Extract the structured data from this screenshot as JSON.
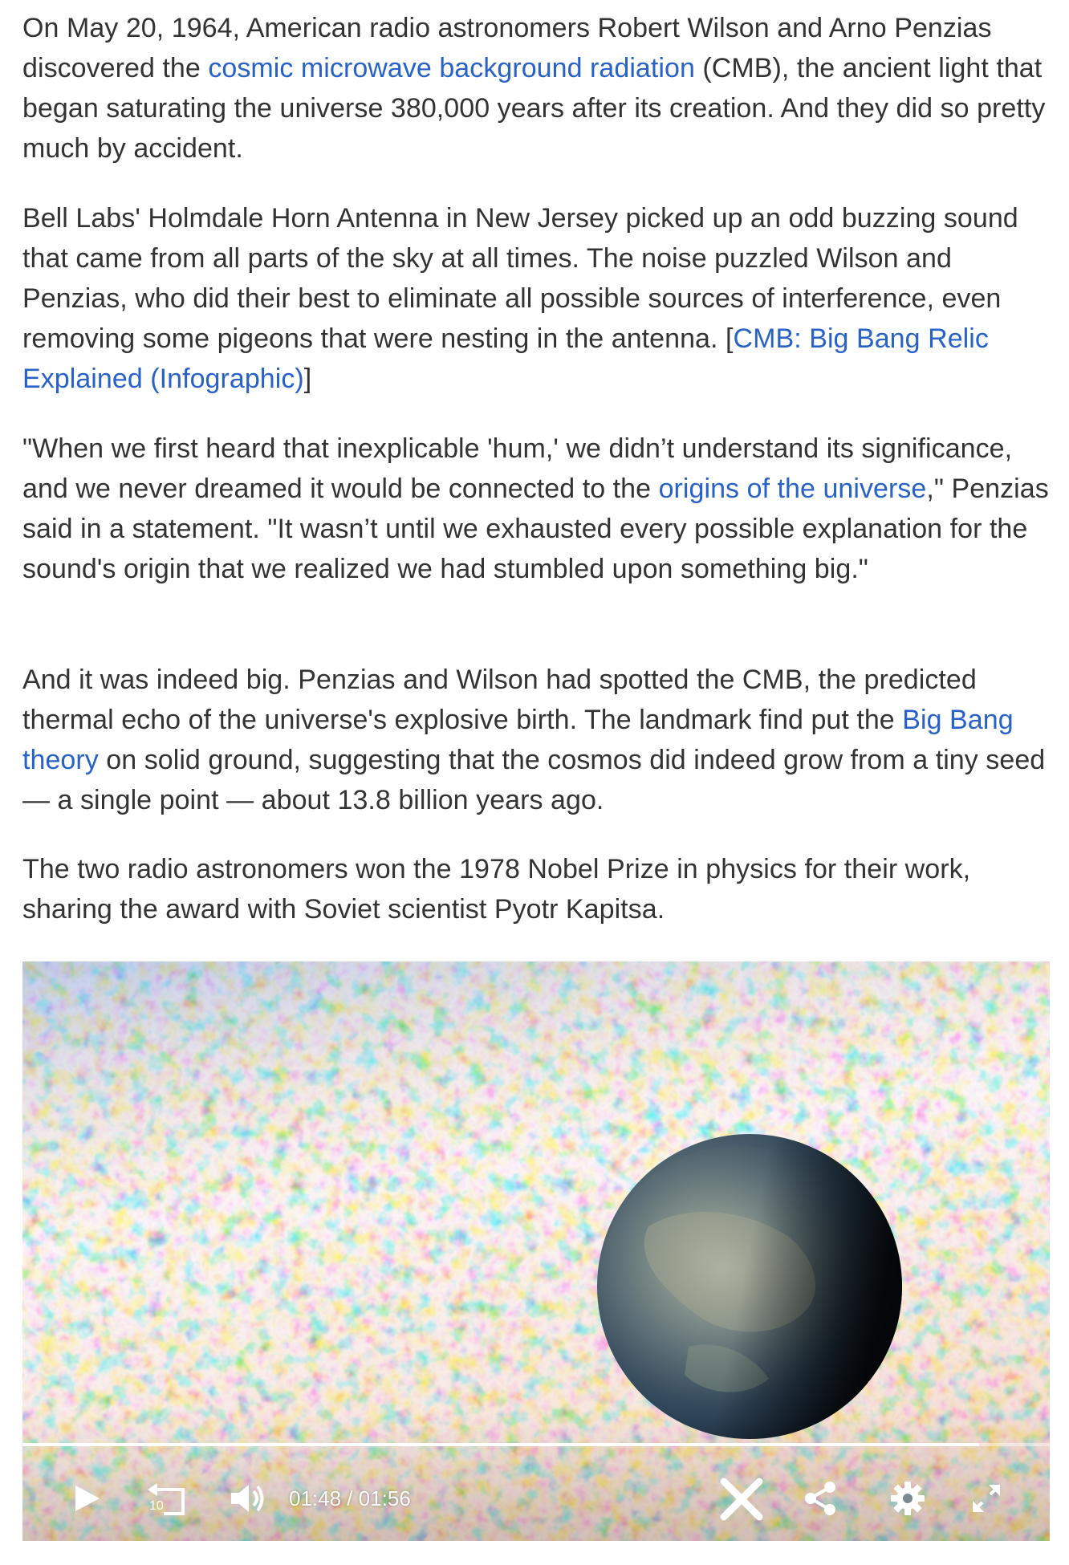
{
  "article": {
    "p1": {
      "before": "On May 20, 1964, American radio astronomers Robert Wilson and Arno Penzias discovered the ",
      "link": "cosmic microwave background radiation",
      "after": " (CMB), the ancient light that began saturating the universe 380,000 years after its creation. And they did so pretty much by accident."
    },
    "p2": {
      "before": "Bell Labs' Holmdale Horn Antenna in New Jersey picked up an odd buzzing sound that came from all parts of the sky at all times. The noise puzzled Wilson and Penzias, who did their best to eliminate all possible sources of interference, even removing some pigeons that were nesting in the antenna. [",
      "link": "CMB: Big Bang Relic Explained (Infographic)",
      "after": "]"
    },
    "p3": {
      "before": "\"When we first heard that inexplicable 'hum,' we didn’t understand its significance, and we never dreamed it would be connected to the ",
      "link": "origins of the universe",
      "after": ",\" Penzias said in a statement. \"It wasn’t until we exhausted every possible explanation for the sound's origin that we realized we had stumbled upon something big.\""
    },
    "p4": {
      "before": "And it was indeed big. Penzias and Wilson had spotted the CMB, the predicted thermal echo of the universe's explosive birth. The landmark find put the ",
      "link": "Big Bang theory",
      "after": " on solid ground, suggesting that the cosmos did indeed grow from a tiny seed — a single point — about 13.8 billion years ago."
    },
    "p5": {
      "text": "The two radio astronomers won the 1978 Nobel Prize in physics for their work, sharing the award with Soviet scientist Pyotr Kapitsa."
    }
  },
  "video": {
    "current_time": "01:48",
    "separator": " / ",
    "duration": "01:56",
    "progress": 0.93,
    "rewind_label": "10",
    "icons": [
      "play-icon",
      "rewind-10-icon",
      "volume-icon",
      "close-icon",
      "share-icon",
      "settings-gear-icon",
      "fullscreen-icon"
    ]
  },
  "colors": {
    "text": "#333333",
    "link": "#2862c9",
    "cmb_warm": "#d2691e",
    "cmb_cool": "#2f6fd6"
  }
}
